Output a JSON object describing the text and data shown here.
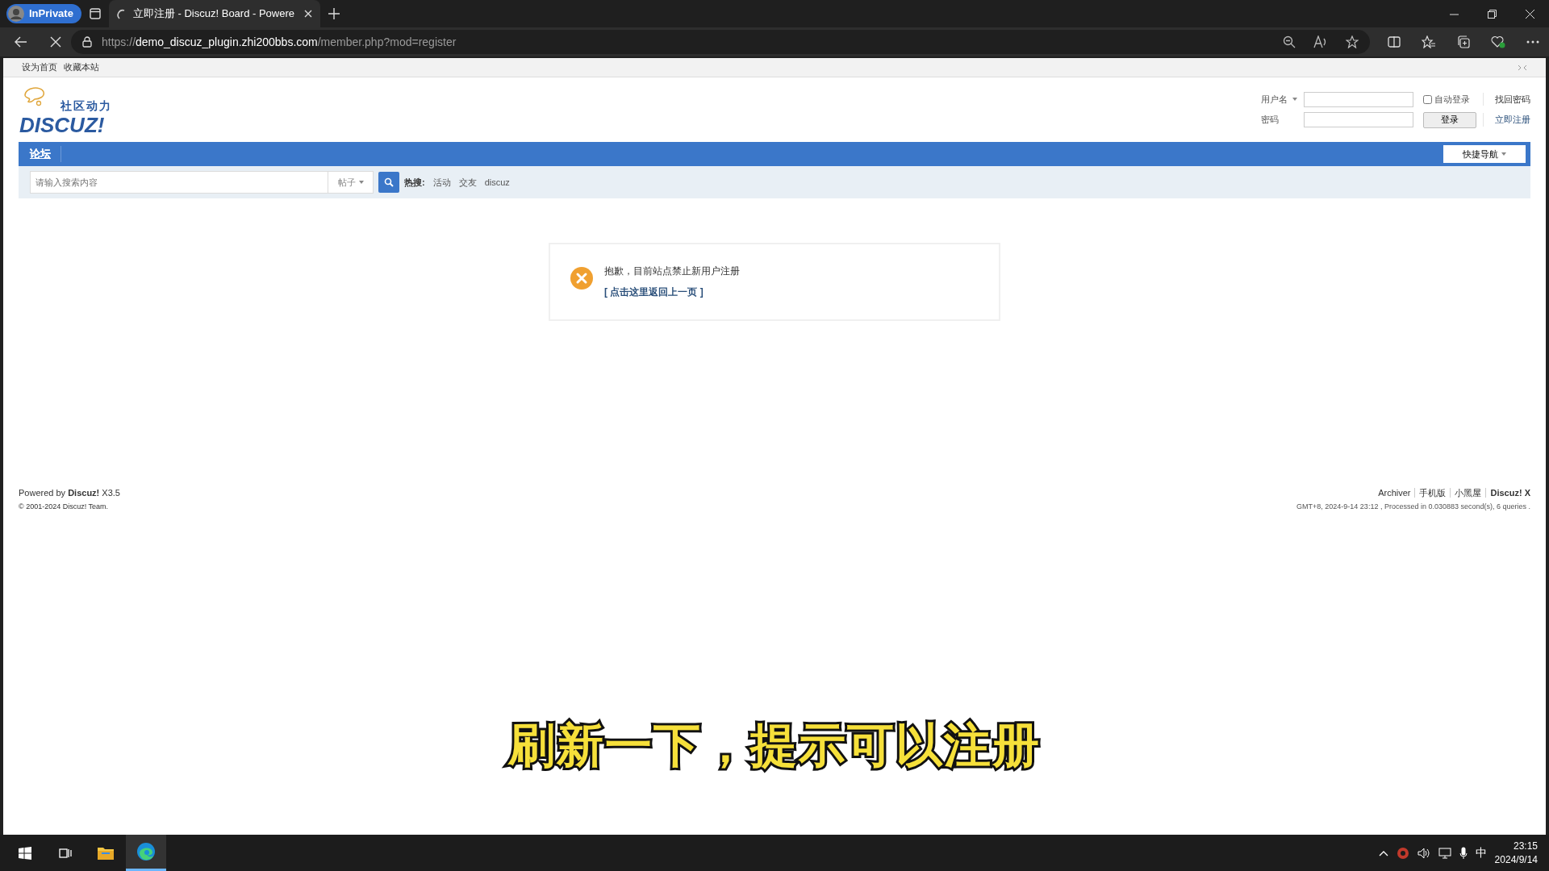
{
  "browser": {
    "inprivate": "InPrivate",
    "tab": {
      "title": "立即注册 - Discuz! Board - Powere",
      "loading": true
    },
    "url": {
      "scheme": "https://",
      "host": "demo_discuz_plugin.zhi200bbs.com",
      "path": "/member.php?mod=register"
    }
  },
  "top_links": [
    "设为首页",
    "收藏本站"
  ],
  "logo": {
    "slogan": "社区动力",
    "name": "DISCUZ!"
  },
  "login": {
    "username_label": "用户名",
    "password_label": "密码",
    "auto_login": {
      "label": "自动登录",
      "checked": false
    },
    "button": "登录",
    "forgot": "找回密码",
    "register": "立即注册"
  },
  "nav": {
    "items": [
      {
        "label": "论坛",
        "selected": true
      }
    ],
    "quick_nav": "快捷导航"
  },
  "search": {
    "placeholder": "请输入搜索内容",
    "type": "帖子",
    "hot_label": "热搜:",
    "hot": [
      "活动",
      "交友",
      "discuz"
    ]
  },
  "message": {
    "text": "抱歉，目前站点禁止新用户注册",
    "link": "[ 点击这里返回上一页 ]"
  },
  "footer": {
    "powered": "Powered by **Discuz!** X3.5",
    "copyright": "© 2001-2024 Discuz! Team.",
    "links": [
      {
        "label": "Archiver",
        "bold": false
      },
      {
        "label": "手机版",
        "bold": false
      },
      {
        "label": "小黑屋",
        "bold": false
      },
      {
        "label": "Discuz! X",
        "bold": true
      }
    ],
    "stats": "GMT+8, 2024-9-14 23:12 , Processed in 0.030883 second(s), 6 queries ."
  },
  "subtitle": "刷新一下，提示可以注册",
  "taskbar": {
    "ime": "中",
    "time": "23:15",
    "date": "2024/9/14"
  }
}
